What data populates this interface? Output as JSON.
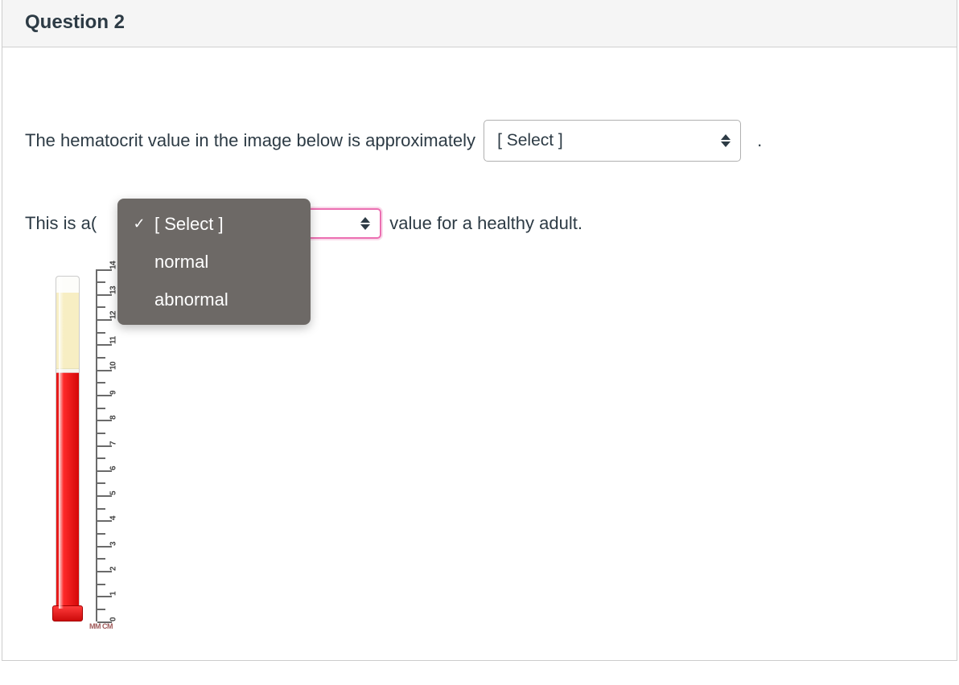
{
  "header": {
    "title": "Question 2"
  },
  "line1": {
    "text_before": "The hematocrit value in the image below is approximately",
    "select_placeholder": "[ Select ]",
    "text_after": "."
  },
  "line2": {
    "text_before": "This is a(",
    "select_placeholder": "",
    "text_after": "value for a healthy adult."
  },
  "dropdown": {
    "options": [
      {
        "label": "[ Select ]",
        "checked": true
      },
      {
        "label": "normal",
        "checked": false
      },
      {
        "label": "abnormal",
        "checked": false
      }
    ]
  },
  "ruler": {
    "unit": "MM CM",
    "ticks": [
      "14",
      "13",
      "12",
      "11",
      "10",
      "9",
      "8",
      "7",
      "6",
      "5",
      "4",
      "3",
      "2",
      "1",
      "0"
    ]
  }
}
